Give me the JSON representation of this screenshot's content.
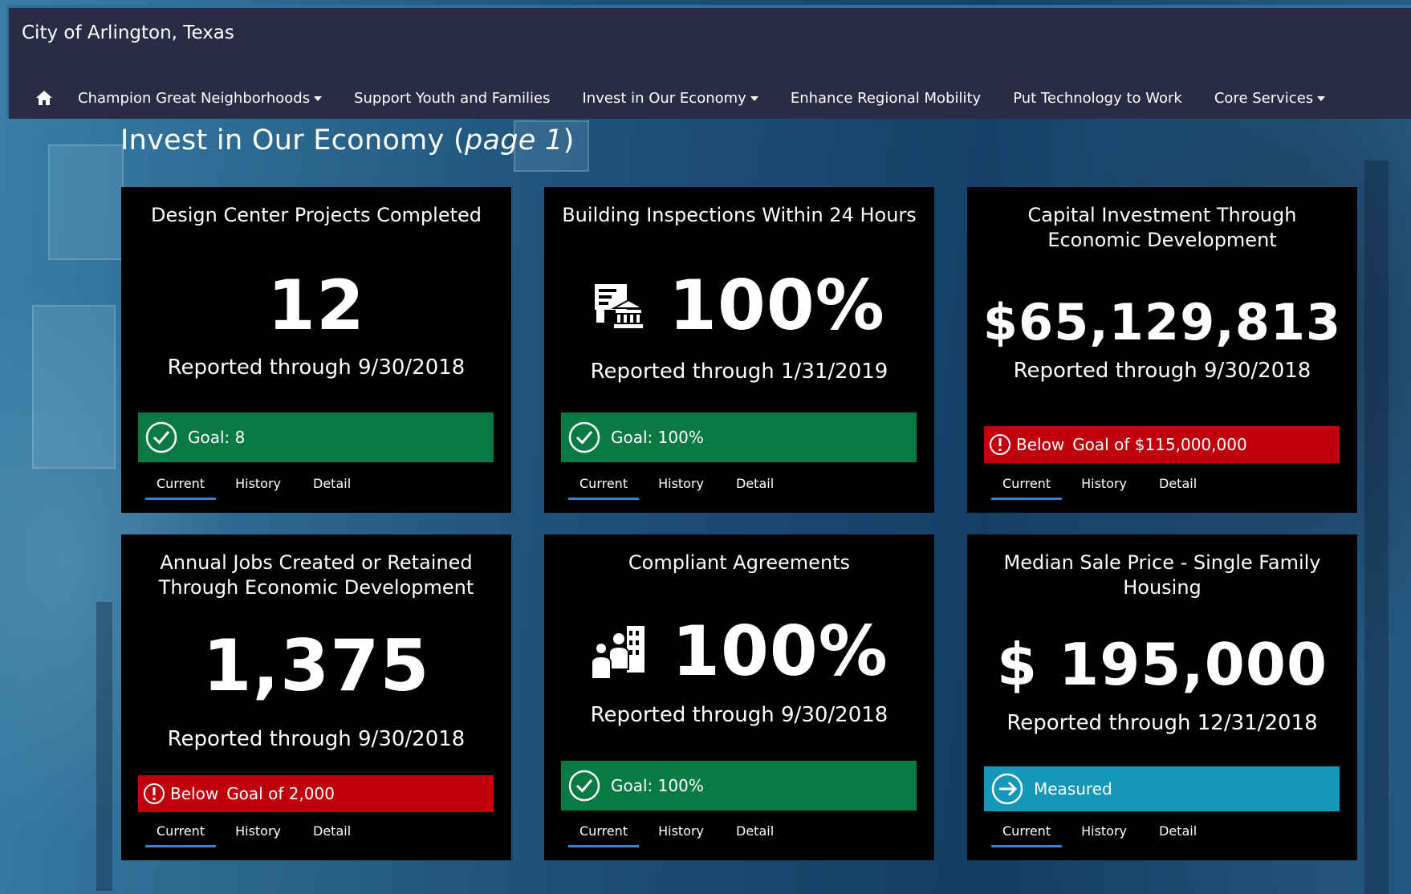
{
  "site": {
    "title": "City of Arlington, Texas"
  },
  "nav": {
    "items": [
      {
        "label": "Champion Great Neighborhoods",
        "dropdown": true
      },
      {
        "label": "Support Youth and Families",
        "dropdown": false
      },
      {
        "label": "Invest in Our Economy",
        "dropdown": true
      },
      {
        "label": "Enhance Regional Mobility",
        "dropdown": false
      },
      {
        "label": "Put Technology to Work",
        "dropdown": false
      },
      {
        "label": "Core Services",
        "dropdown": true
      }
    ]
  },
  "page": {
    "heading": "Invest in Our Economy",
    "heading_suffix": "page 1"
  },
  "tabs": {
    "current": "Current",
    "history": "History",
    "detail": "Detail"
  },
  "colors": {
    "goal_met": "#0a7a45",
    "below_goal": "#c0000c",
    "measured": "#1597b9",
    "tab_underline": "#2f86d8"
  },
  "cards": [
    {
      "title": "Design Center Projects Completed",
      "value": "12",
      "reported": "Reported through 9/30/2018",
      "status": {
        "type": "goal-met",
        "icon": "check-circle-icon",
        "text": "Goal: 8"
      }
    },
    {
      "title": "Building Inspections Within 24 Hours",
      "value": "100%",
      "icon": "building-inspection-icon",
      "reported": "Reported through 1/31/2019",
      "status": {
        "type": "goal-met",
        "icon": "check-circle-icon",
        "text": "Goal: 100%"
      }
    },
    {
      "title": "Capital Investment Through Economic Development",
      "value": "$65,129,813",
      "reported": "Reported through 9/30/2018",
      "status": {
        "type": "below-goal",
        "icon": "alert-circle-icon",
        "label": "Below",
        "text": "Goal of $115,000,000"
      }
    },
    {
      "title": "Annual Jobs Created or Retained Through Economic Development",
      "value": "1,375",
      "reported": "Reported through 9/30/2018",
      "status": {
        "type": "below-goal",
        "icon": "alert-circle-icon",
        "label": "Below",
        "text": "Goal of 2,000"
      }
    },
    {
      "title": "Compliant Agreements",
      "value": "100%",
      "icon": "people-building-icon",
      "reported": "Reported through 9/30/2018",
      "status": {
        "type": "goal-met",
        "icon": "check-circle-icon",
        "text": "Goal: 100%"
      }
    },
    {
      "title": "Median Sale Price - Single Family Housing",
      "value": "$ 195,000",
      "reported": "Reported through 12/31/2018",
      "status": {
        "type": "measured",
        "icon": "arrow-right-circle-icon",
        "text": "Measured"
      }
    }
  ]
}
